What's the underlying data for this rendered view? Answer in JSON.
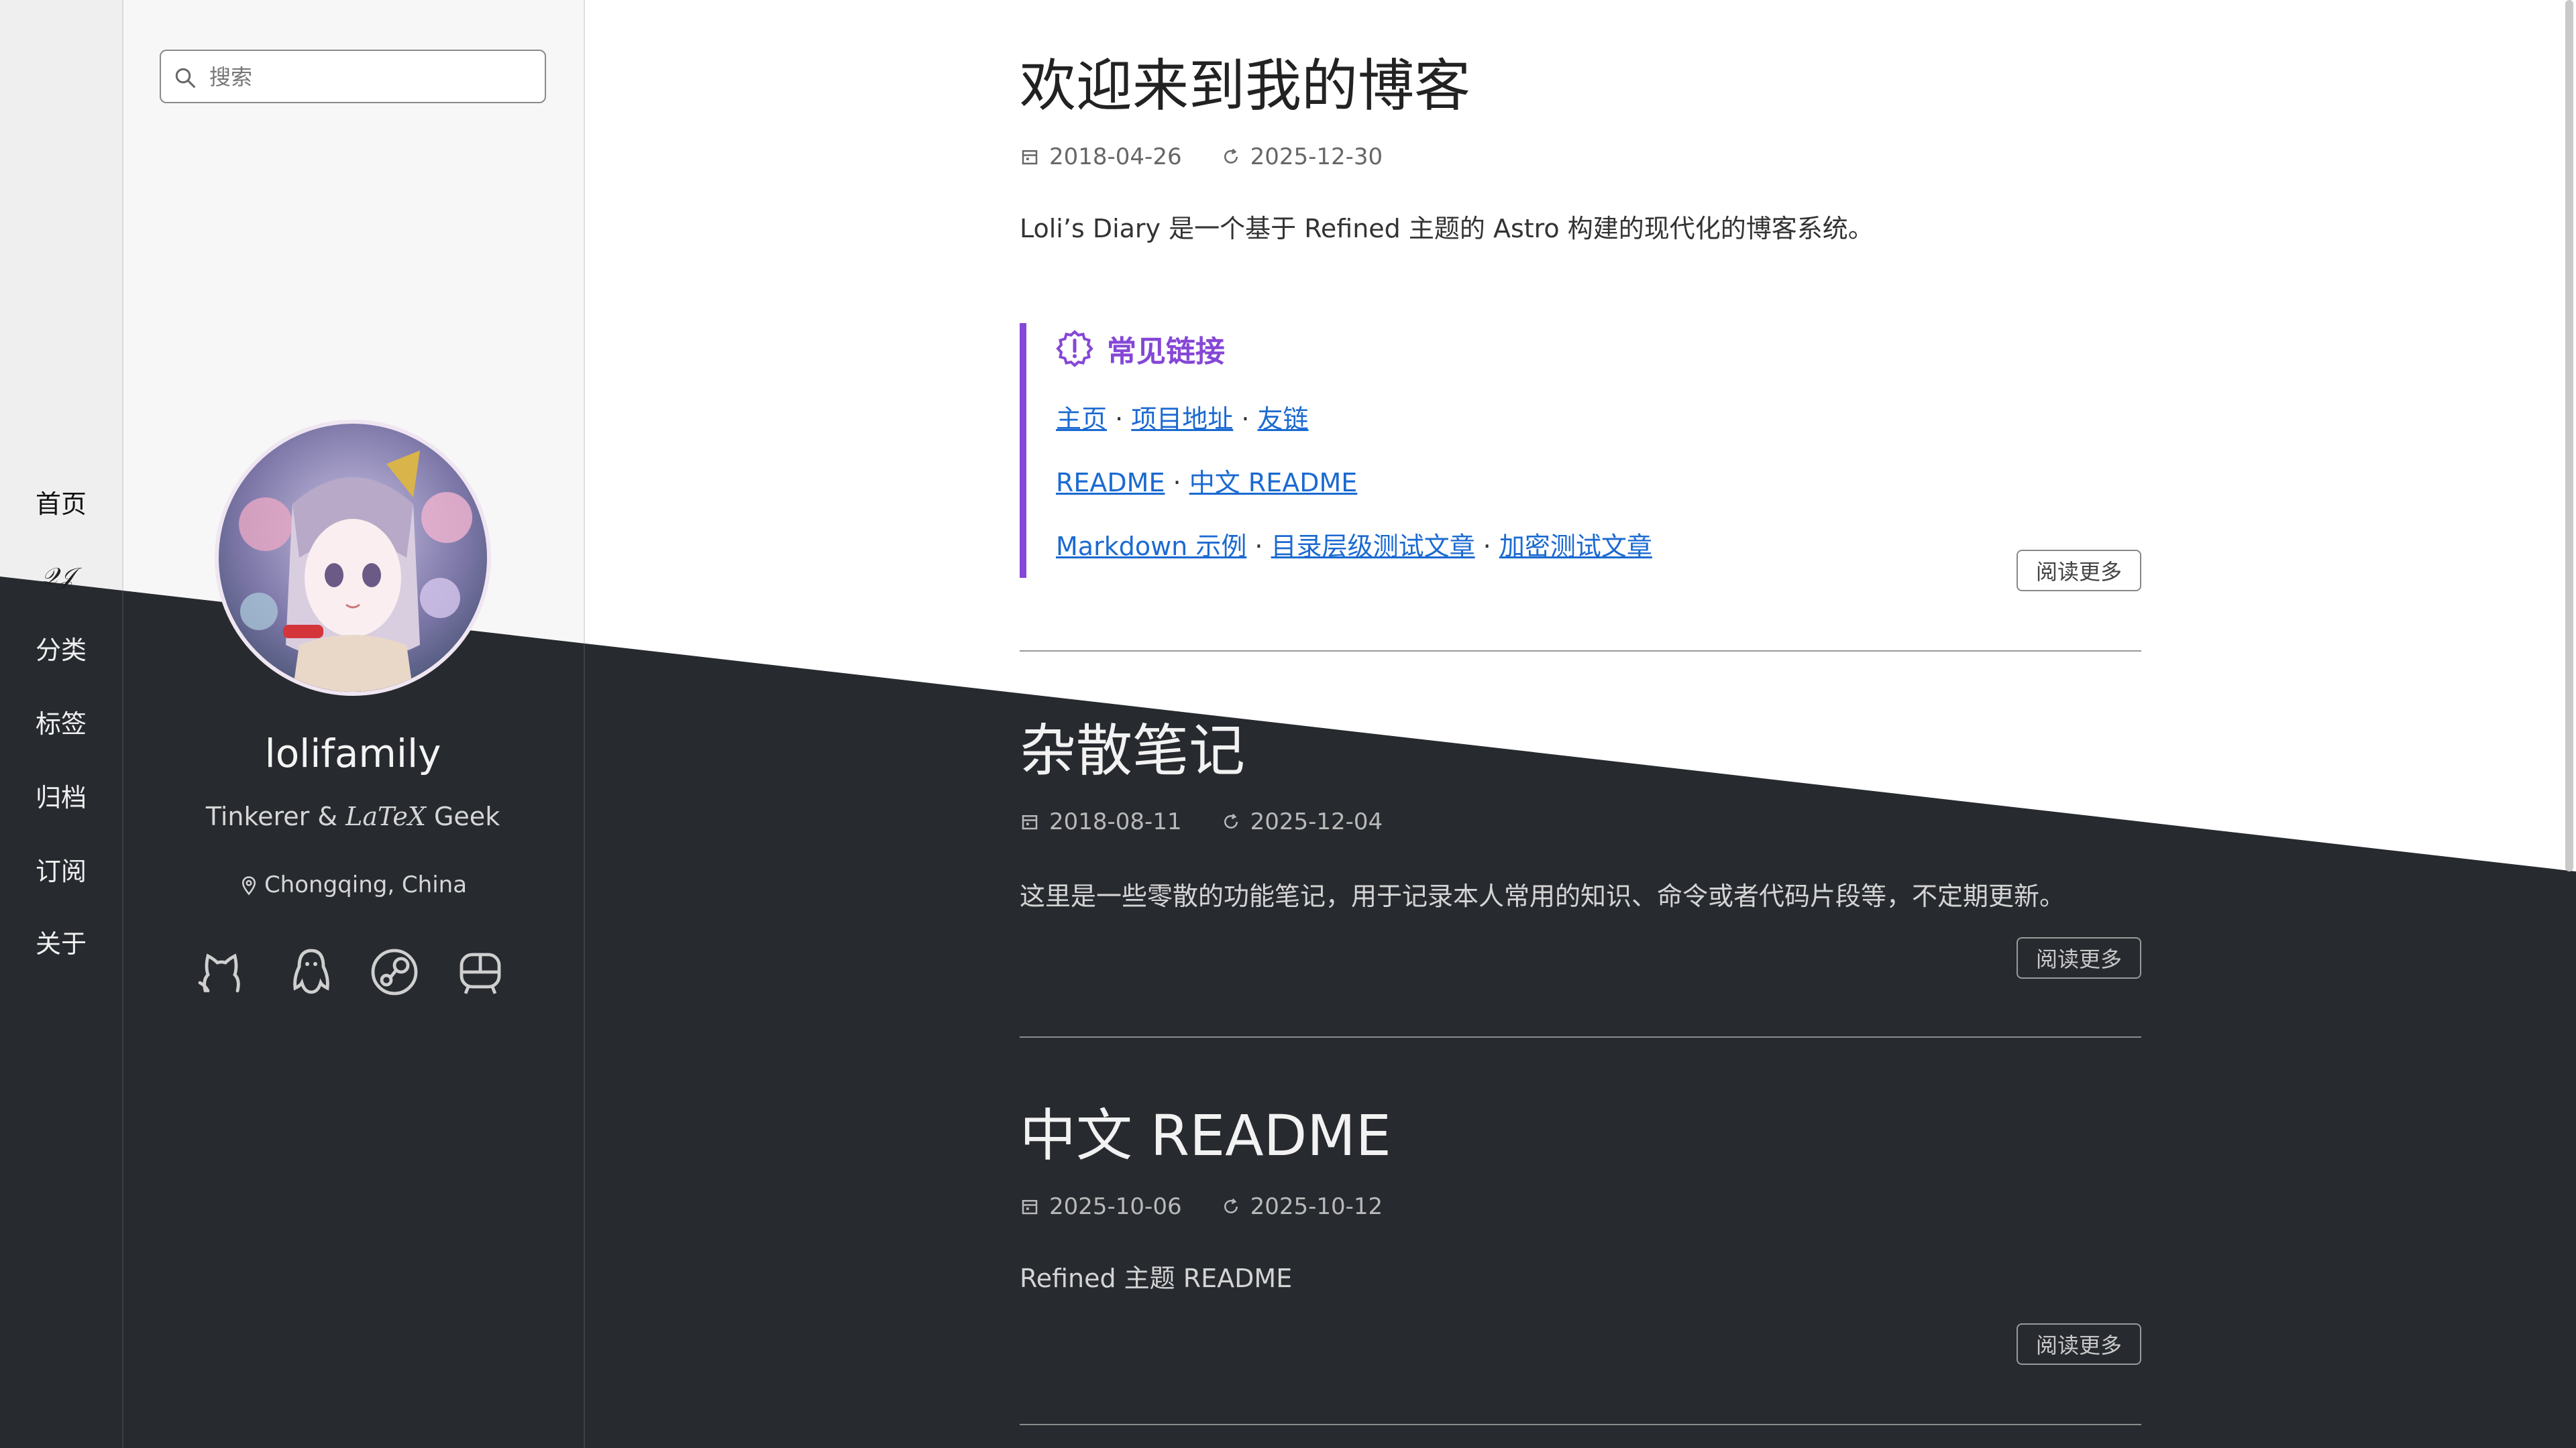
{
  "nav": {
    "logo_text": "𝒬𝒥",
    "items": [
      "首页",
      "分类",
      "标签",
      "归档",
      "订阅",
      "关于"
    ]
  },
  "sidebar": {
    "search_placeholder": "搜索",
    "name": "lolifamily",
    "tagline_start": "Tinkerer & ",
    "tagline_latex": "LaTeX",
    "tagline_end": " Geek",
    "location": "Chongqing, China",
    "social_icons": [
      "github-icon",
      "qq-penguin-icon",
      "steam-icon",
      "bilibili-tv-icon"
    ]
  },
  "posts": [
    {
      "title": "欢迎来到我的博客",
      "created": "2018-04-26",
      "updated": "2025-12-30",
      "excerpt": "Loli’s Diary 是一个基于 Refined 主题的 Astro 构建的现代化的博客系统。",
      "callout": {
        "title": "常见链接",
        "rows": [
          [
            "主页",
            "项目地址",
            "友链"
          ],
          [
            "README",
            "中文 README"
          ],
          [
            "Markdown 示例",
            "目录层级测试文章",
            "加密测试文章"
          ]
        ]
      },
      "read_more": "阅读更多"
    },
    {
      "title": "杂散笔记",
      "created": "2018-08-11",
      "updated": "2025-12-04",
      "excerpt": "这里是一些零散的功能笔记，用于记录本人常用的知识、命令或者代码片段等，不定期更新。",
      "read_more": "阅读更多"
    },
    {
      "title": "中文 README",
      "created": "2025-10-06",
      "updated": "2025-10-12",
      "excerpt": "Refined 主题 README",
      "read_more": "阅读更多"
    }
  ],
  "colors": {
    "accent": "#8547d6",
    "link": "#1b6ad1",
    "dark_bg": "#272a2f",
    "light_bg": "#ffffff"
  }
}
